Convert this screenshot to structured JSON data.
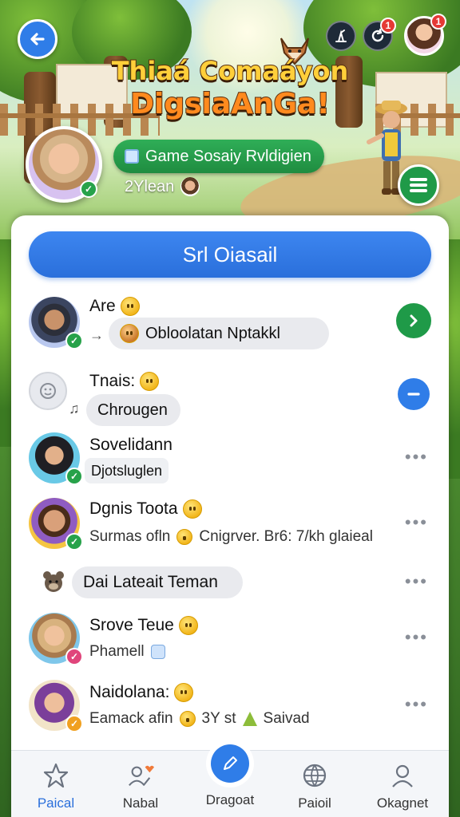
{
  "header": {
    "title_line1": "Thiaá Comaáyon",
    "title_line2": "DigsiaAnGa!",
    "game_pill": "Game Sosaiy Rvldigien",
    "sub_text": "2Ylean",
    "notif_badge_1": "1",
    "notif_badge_2": "1"
  },
  "panel": {
    "search_button": "Srl Oiasail",
    "rows": [
      {
        "name": "Are",
        "chip": "Obloolatan Nptakkl"
      },
      {
        "name": "Tnais:",
        "chip": "Chrougen"
      },
      {
        "name": "Sovelidann",
        "chip": "Djotsluglen"
      },
      {
        "name": "Dgnis Toota",
        "sub": "Surmas ofln",
        "sub2": "Cnigrver. Br6: 7/kh glaieal"
      },
      {
        "chip": "Dai Lateait Teman"
      },
      {
        "name": "Srove Teue",
        "sub": "Phamell"
      },
      {
        "name": "Naidolana:",
        "sub": "Eamack afin",
        "sub2": "3Y st",
        "sub3": "Saivad"
      }
    ],
    "more_label": "•••"
  },
  "nav": {
    "items": [
      {
        "label": "Paical",
        "icon": "star-icon"
      },
      {
        "label": "Nabal",
        "icon": "people-icon"
      },
      {
        "label": "Dragoat",
        "icon": "pen-icon"
      },
      {
        "label": "Paioil",
        "icon": "globe-icon"
      },
      {
        "label": "Okagnet",
        "icon": "person-icon"
      }
    ],
    "active_color": "#2a6fdb"
  },
  "colors": {
    "primary_blue": "#2f7de8",
    "green": "#1f9a48",
    "danger": "#e53935"
  }
}
